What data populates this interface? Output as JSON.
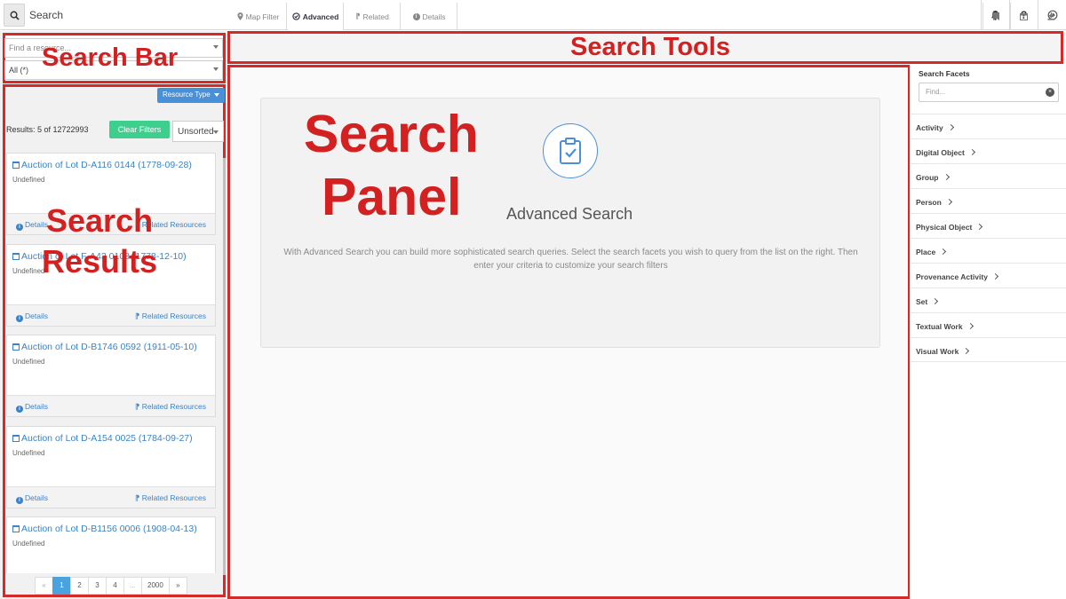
{
  "topbar": {
    "search_label": "Search",
    "actions": [
      {
        "icon": "bell-icon"
      },
      {
        "label": "?"
      },
      {
        "icon": "sign-out-icon"
      }
    ]
  },
  "search_bar": {
    "resource_placeholder": "Find a resource...",
    "scope_value": "All (*)"
  },
  "results": {
    "resource_type_label": "Resource Type",
    "count_text": "Results: 5 of 12722993",
    "clear_filters_label": "Clear Filters",
    "sort_value": "Unsorted",
    "details_label": "Details",
    "related_label": "Related Resources",
    "items": [
      {
        "title": "Auction of Lot D-A116 0144 (1778-09-28)",
        "subtitle": "Undefined"
      },
      {
        "title": "Auction of Lot F-A43 0108 (1778-12-10)",
        "subtitle": "Undefined"
      },
      {
        "title": "Auction of Lot D-B1746 0592 (1911-05-10)",
        "subtitle": "Undefined"
      },
      {
        "title": "Auction of Lot D-A154 0025 (1784-09-27)",
        "subtitle": "Undefined"
      },
      {
        "title": "Auction of Lot D-B1156 0006 (1908-04-13)",
        "subtitle": "Undefined"
      }
    ],
    "pagination": [
      "«",
      "1",
      "2",
      "3",
      "4",
      "...",
      "2000",
      "»"
    ],
    "active_page": "1"
  },
  "tools": {
    "tabs": [
      {
        "label": "Map Filter",
        "icon": "map-marker-icon",
        "active": false
      },
      {
        "label": "Advanced",
        "icon": "check-circle-icon",
        "active": true
      },
      {
        "label": "Related",
        "icon": "related-icon",
        "active": false
      },
      {
        "label": "Details",
        "icon": "info-icon",
        "active": false
      }
    ],
    "right_icons": [
      "bookmark-icon",
      "calendar-icon",
      "download-icon"
    ]
  },
  "panel": {
    "title": "Advanced Search",
    "description": "With Advanced Search you can build more sophisticated search queries. Select the search facets you wish to query from the list on the right. Then enter your criteria to customize your search filters"
  },
  "facets": {
    "title": "Search Facets",
    "find_placeholder": "Find...",
    "items": [
      "Activity",
      "Digital Object",
      "Group",
      "Person",
      "Physical Object",
      "Place",
      "Provenance Activity",
      "Set",
      "Textual Work",
      "Visual Work"
    ]
  },
  "annotations": {
    "search_bar": "Search Bar",
    "search_tools": "Search Tools",
    "search_panel_line1": "Search",
    "search_panel_line2": "Panel",
    "search_results_line1": "Search",
    "search_results_line2": "Results"
  },
  "colors": {
    "annotation_red": "#d32020",
    "link_blue": "#3b83c6",
    "clear_green": "#3ecf8e",
    "active_page_blue": "#4aa3df"
  }
}
